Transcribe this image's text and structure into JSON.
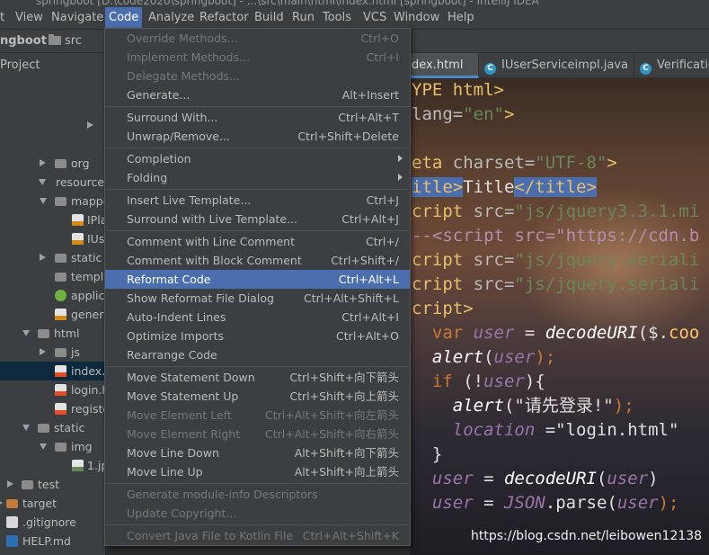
{
  "window": {
    "title_fragment": "springboot [D:\\code2020\\springboot] - ...\\src\\main\\html\\index.html [springboot] - IntelliJ IDEA"
  },
  "menubar": {
    "items": [
      "t",
      "View",
      "Navigate",
      "Code",
      "Analyze",
      "Refactor",
      "Build",
      "Run",
      "Tools",
      "VCS",
      "Window",
      "Help"
    ],
    "active": "Code"
  },
  "navbar": {
    "crumbs": [
      "ngboot",
      "src"
    ]
  },
  "project": {
    "header": "Project",
    "tree": [
      {
        "label": "org"
      },
      {
        "label": "resources"
      },
      {
        "label": "mappe"
      },
      {
        "label": "IPla"
      },
      {
        "label": "IUs"
      },
      {
        "label": "static"
      },
      {
        "label": "templa"
      },
      {
        "label": "applica"
      },
      {
        "label": "genera"
      },
      {
        "label": "html"
      },
      {
        "label": "js"
      },
      {
        "label": "index.h"
      },
      {
        "label": "login.h"
      },
      {
        "label": "registe"
      },
      {
        "label": "static"
      },
      {
        "label": "img"
      },
      {
        "label": "1.jp"
      },
      {
        "label": "test"
      },
      {
        "label": "target"
      },
      {
        "label": ".gitignore"
      },
      {
        "label": "HELP.md"
      }
    ]
  },
  "tabs": [
    {
      "label": "dex.html"
    },
    {
      "label": "IUserServiceimpl.java"
    },
    {
      "label": "Verification"
    }
  ],
  "editor": {
    "lines": [
      {
        "a": "YPE ",
        "b": "html",
        "c": ">"
      },
      {
        "a": "lang=",
        "b": "\"en\"",
        "c": ">"
      },
      {
        "a": "",
        "b": "",
        "c": ""
      },
      {
        "a": "eta ",
        "b": "charset=",
        "c": "\"UTF-8\"",
        "d": ">"
      },
      {
        "a": "itle>",
        "b": "Title",
        "c": "</title>"
      },
      {
        "a": "cript ",
        "b": "src=",
        "c": "\"js/jquery3.3.1.mi"
      },
      {
        "a": "--<script ",
        "b": "src=",
        "c": "\"https://cdn.b"
      },
      {
        "a": "cript ",
        "b": "src=",
        "c": "\"js/jquery.seriali"
      },
      {
        "a": "cript ",
        "b": "src=",
        "c": "\"js/jquery.seriali"
      },
      {
        "a": "cript>",
        "b": "",
        "c": ""
      },
      {
        "a": "  var ",
        "b": "user",
        "c": " = ",
        "d": "decodeURI",
        "e": "($.",
        "f": "coo"
      },
      {
        "a": "  ",
        "b": "alert",
        "c": "(",
        "d": "user",
        "e": ");"
      },
      {
        "a": "  if ",
        "b": "(!",
        "c": "user",
        "d": "){"
      },
      {
        "a": "    ",
        "b": "alert",
        "c": "(",
        "d": "\"请先登录!\"",
        "e": ");"
      },
      {
        "a": "    ",
        "b": "location",
        "c": " =",
        "d": "\"login.html\""
      },
      {
        "a": "  }",
        "b": "",
        "c": ""
      },
      {
        "a": "  ",
        "b": "user",
        "c": " = ",
        "d": "decodeURI",
        "e": "(",
        "f": "user",
        "g": ")"
      },
      {
        "a": "  ",
        "b": "user",
        "c": " = ",
        "d": "JSON",
        "e": ".parse(",
        "f": "user",
        "g": ");"
      }
    ]
  },
  "code_menu": {
    "items": [
      {
        "label": "Override Methods...",
        "shortcut": "Ctrl+O",
        "state": "disabled"
      },
      {
        "label": "Implement Methods...",
        "shortcut": "Ctrl+I",
        "state": "disabled"
      },
      {
        "label": "Delegate Methods...",
        "shortcut": "",
        "state": "disabled"
      },
      {
        "label": "Generate...",
        "shortcut": "Alt+Insert",
        "state": "enabled"
      },
      {
        "label": "Surround With...",
        "shortcut": "Ctrl+Alt+T",
        "state": "enabled"
      },
      {
        "label": "Unwrap/Remove...",
        "shortcut": "Ctrl+Shift+Delete",
        "state": "enabled"
      },
      {
        "label": "Completion",
        "shortcut": "",
        "state": "enabled",
        "submenu": true
      },
      {
        "label": "Folding",
        "shortcut": "",
        "state": "enabled",
        "submenu": true
      },
      {
        "label": "Insert Live Template...",
        "shortcut": "Ctrl+J",
        "state": "enabled"
      },
      {
        "label": "Surround with Live Template...",
        "shortcut": "Ctrl+Alt+J",
        "state": "enabled"
      },
      {
        "label": "Comment with Line Comment",
        "shortcut": "Ctrl+/",
        "state": "enabled"
      },
      {
        "label": "Comment with Block Comment",
        "shortcut": "Ctrl+Shift+/",
        "state": "enabled"
      },
      {
        "label": "Reformat Code",
        "shortcut": "Ctrl+Alt+L",
        "state": "highlight"
      },
      {
        "label": "Show Reformat File Dialog",
        "shortcut": "Ctrl+Alt+Shift+L",
        "state": "enabled"
      },
      {
        "label": "Auto-Indent Lines",
        "shortcut": "Ctrl+Alt+I",
        "state": "enabled"
      },
      {
        "label": "Optimize Imports",
        "shortcut": "Ctrl+Alt+O",
        "state": "enabled"
      },
      {
        "label": "Rearrange Code",
        "shortcut": "",
        "state": "enabled"
      },
      {
        "label": "Move Statement Down",
        "shortcut": "Ctrl+Shift+向下箭头",
        "state": "enabled"
      },
      {
        "label": "Move Statement Up",
        "shortcut": "Ctrl+Shift+向上箭头",
        "state": "enabled"
      },
      {
        "label": "Move Element Left",
        "shortcut": "Ctrl+Alt+Shift+向左箭头",
        "state": "disabled"
      },
      {
        "label": "Move Element Right",
        "shortcut": "Ctrl+Alt+Shift+向右箭头",
        "state": "disabled"
      },
      {
        "label": "Move Line Down",
        "shortcut": "Alt+Shift+向下箭头",
        "state": "enabled"
      },
      {
        "label": "Move Line Up",
        "shortcut": "Alt+Shift+向上箭头",
        "state": "enabled"
      },
      {
        "label": "Generate module-info Descriptors",
        "shortcut": "",
        "state": "disabled"
      },
      {
        "label": "Update Copyright...",
        "shortcut": "",
        "state": "disabled"
      },
      {
        "label": "Convert Java File to Kotlin File",
        "shortcut": "Ctrl+Alt+Shift+K",
        "state": "disabled"
      }
    ]
  },
  "watermark": "https://blog.csdn.net/leibowen12138",
  "colors": {
    "menu_bg": "#3c3f41",
    "highlight": "#4b6eaf",
    "disabled_text": "#777777",
    "enabled_text": "#bbbbbb"
  }
}
